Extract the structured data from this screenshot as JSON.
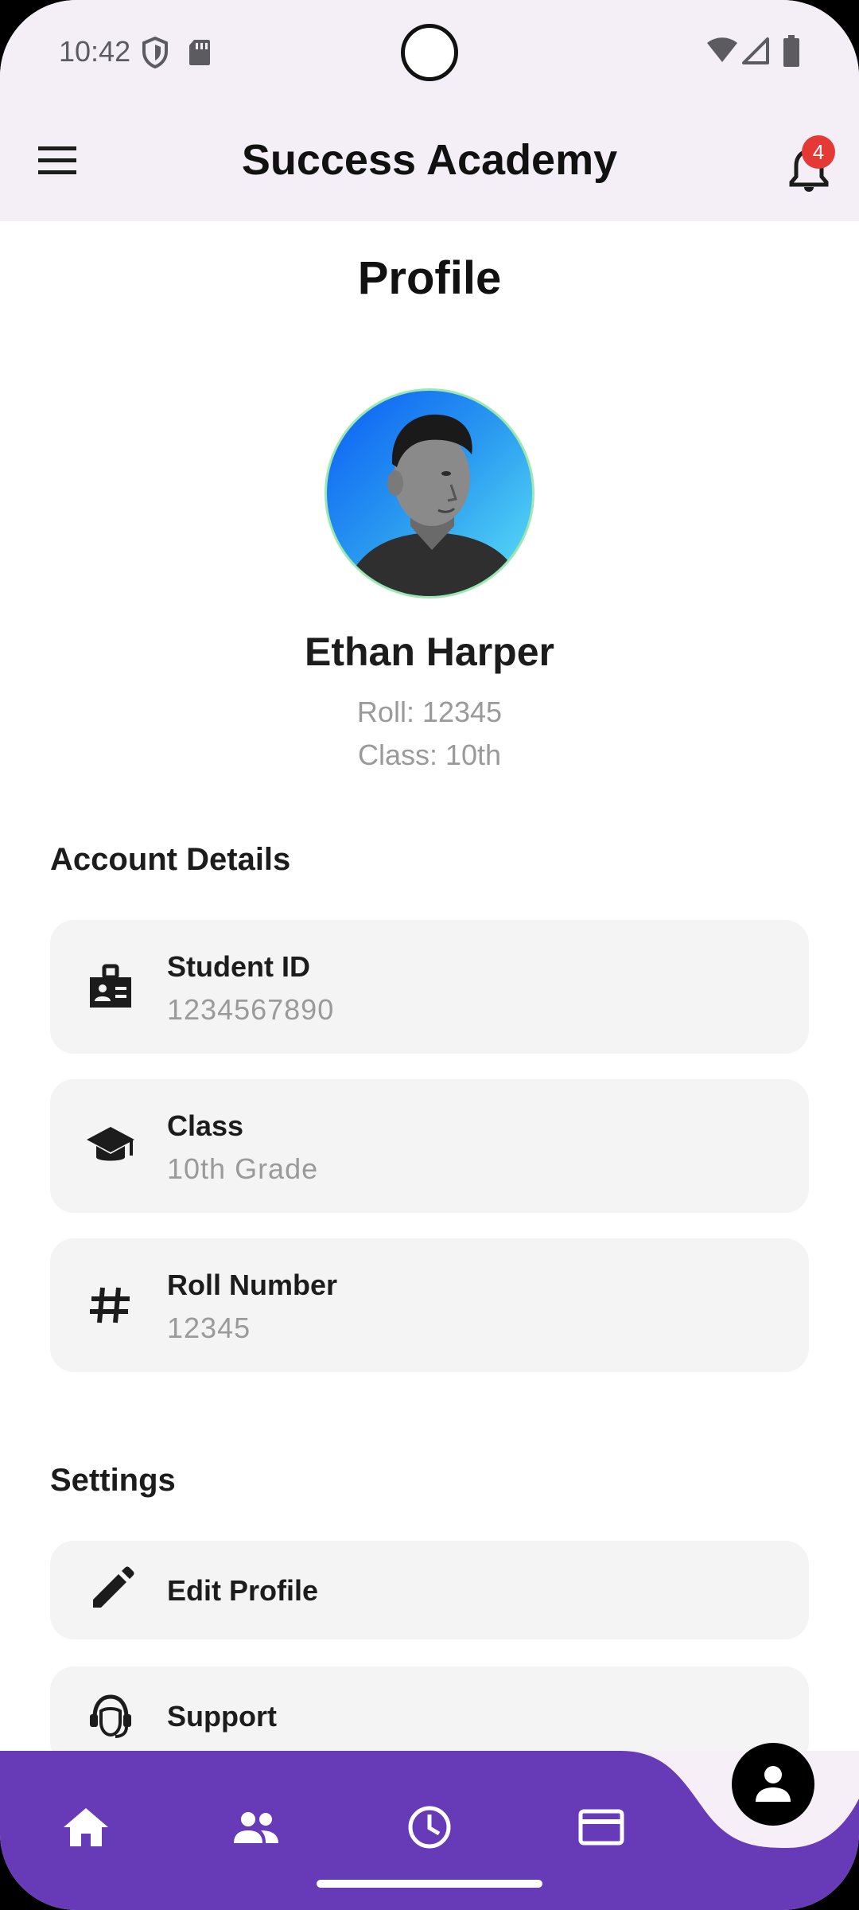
{
  "status_bar": {
    "time": "10:42"
  },
  "app_bar": {
    "title": "Success Academy",
    "notification_count": "4"
  },
  "page": {
    "title": "Profile"
  },
  "profile": {
    "name": "Ethan Harper",
    "roll_line": "Roll: 12345",
    "class_line": "Class: 10th"
  },
  "account_details": {
    "title": "Account Details",
    "items": [
      {
        "icon": "badge-icon",
        "label": "Student ID",
        "value": "1234567890"
      },
      {
        "icon": "graduation-cap-icon",
        "label": "Class",
        "value": "10th Grade"
      },
      {
        "icon": "hashtag-icon",
        "label": "Roll Number",
        "value": "12345"
      }
    ]
  },
  "settings": {
    "title": "Settings",
    "items": [
      {
        "icon": "pencil-icon",
        "label": "Edit Profile"
      },
      {
        "icon": "support-agent-icon",
        "label": "Support"
      }
    ]
  },
  "bottom_nav": {
    "items": [
      "home-icon",
      "people-icon",
      "clock-icon",
      "card-icon"
    ],
    "fab_icon": "person-icon"
  },
  "colors": {
    "nav_purple": "#673ab7",
    "header_bg": "#f4eff6",
    "card_bg": "#f4f4f4",
    "badge_red": "#e53935"
  }
}
